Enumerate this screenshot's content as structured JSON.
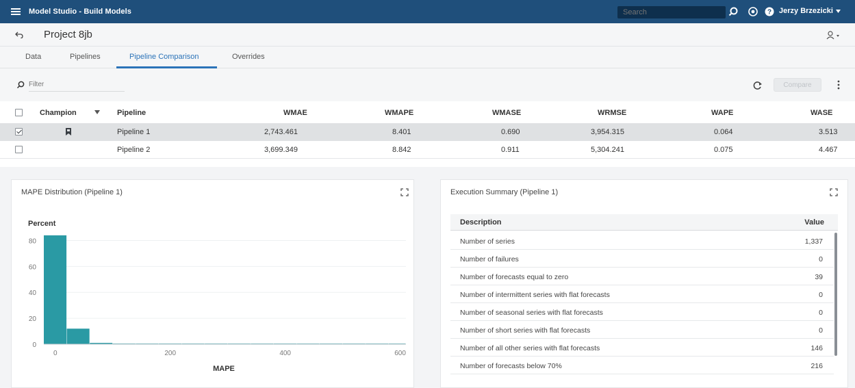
{
  "header": {
    "app_title": "Model Studio - Build Models",
    "search_placeholder": "Search",
    "user_name": "Jerzy Brzezicki"
  },
  "project": {
    "title": "Project 8jb"
  },
  "tabs": [
    {
      "label": "Data"
    },
    {
      "label": "Pipelines"
    },
    {
      "label": "Pipeline Comparison",
      "active": true
    },
    {
      "label": "Overrides"
    }
  ],
  "filter": {
    "placeholder": "Filter",
    "compare_label": "Compare"
  },
  "table": {
    "headers": [
      "Champion",
      "Pipeline",
      "WMAE",
      "WMAPE",
      "WMASE",
      "WRMSE",
      "WAPE",
      "WASE"
    ],
    "rows": [
      {
        "checked": true,
        "champion": true,
        "pipeline": "Pipeline 1",
        "wmae": "2,743.461",
        "wmape": "8.401",
        "wmase": "0.690",
        "wrmse": "3,954.315",
        "wape": "0.064",
        "wase": "3.513"
      },
      {
        "checked": false,
        "champion": false,
        "pipeline": "Pipeline 2",
        "wmae": "3,699.349",
        "wmape": "8.842",
        "wmase": "0.911",
        "wrmse": "5,304.241",
        "wape": "0.075",
        "wase": "4.467"
      }
    ]
  },
  "mape_panel": {
    "title": "MAPE Distribution (Pipeline 1)"
  },
  "chart_data": {
    "type": "bar",
    "title": "",
    "xlabel": "MAPE",
    "ylabel": "Percent",
    "x_ticks": [
      0,
      200,
      400,
      600
    ],
    "y_ticks": [
      0,
      20,
      40,
      60,
      80
    ],
    "xlim": [
      -20,
      610
    ],
    "ylim": [
      0,
      85
    ],
    "bins": [
      {
        "x0": -20,
        "x1": 20,
        "value": 84
      },
      {
        "x0": 20,
        "x1": 60,
        "value": 12
      },
      {
        "x0": 60,
        "x1": 100,
        "value": 1
      },
      {
        "x0": 100,
        "x1": 140,
        "value": 0.5
      },
      {
        "x0": 140,
        "x1": 180,
        "value": 0.5
      },
      {
        "x0": 180,
        "x1": 220,
        "value": 0.5
      },
      {
        "x0": 220,
        "x1": 260,
        "value": 0.5
      },
      {
        "x0": 260,
        "x1": 300,
        "value": 0.5
      },
      {
        "x0": 300,
        "x1": 340,
        "value": 0.5
      },
      {
        "x0": 340,
        "x1": 380,
        "value": 0.5
      },
      {
        "x0": 380,
        "x1": 420,
        "value": 0.5
      },
      {
        "x0": 420,
        "x1": 460,
        "value": 0.5
      },
      {
        "x0": 460,
        "x1": 500,
        "value": 0.5
      },
      {
        "x0": 500,
        "x1": 540,
        "value": 0.5
      },
      {
        "x0": 540,
        "x1": 580,
        "value": 0.5
      },
      {
        "x0": 580,
        "x1": 610,
        "value": 0.5
      }
    ],
    "grid": true,
    "bar_color": "#2a9aa4"
  },
  "summary_panel": {
    "title": "Execution Summary (Pipeline 1)",
    "col_description": "Description",
    "col_value": "Value",
    "rows": [
      {
        "description": "Number of series",
        "value": "1,337"
      },
      {
        "description": "Number of failures",
        "value": "0"
      },
      {
        "description": "Number of forecasts equal to zero",
        "value": "39"
      },
      {
        "description": "Number of intermittent series with flat forecasts",
        "value": "0"
      },
      {
        "description": "Number of seasonal series with flat forecasts",
        "value": "0"
      },
      {
        "description": "Number of short series with flat forecasts",
        "value": "0"
      },
      {
        "description": "Number of all other series with flat forecasts",
        "value": "146"
      },
      {
        "description": "Number of forecasts below 70%",
        "value": "216"
      }
    ]
  },
  "colors": {
    "topbar": "#1f4f7b",
    "accent": "#2b73b8",
    "bar": "#2a9aa4"
  }
}
